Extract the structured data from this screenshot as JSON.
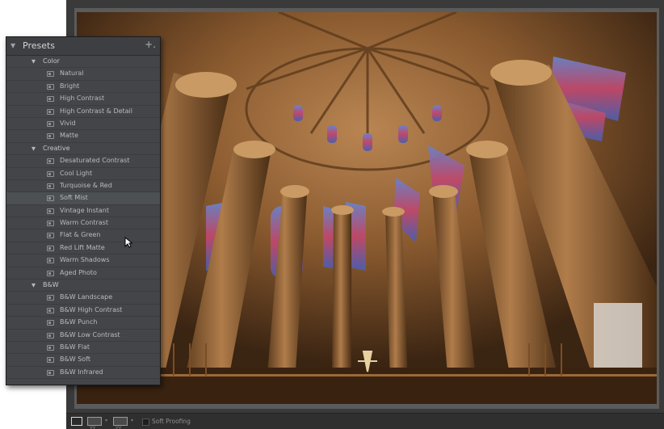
{
  "presets_panel": {
    "title": "Presets",
    "add_label": "+.",
    "folders": [
      {
        "name": "Color",
        "items": [
          "Natural",
          "Bright",
          "High Contrast",
          "High Contrast & Detail",
          "Vivid",
          "Matte"
        ]
      },
      {
        "name": "Creative",
        "items": [
          "Desaturated Contrast",
          "Cool Light",
          "Turquoise & Red",
          "Soft Mist",
          "Vintage Instant",
          "Warm Contrast",
          "Flat & Green",
          "Red Lift Matte",
          "Warm Shadows",
          "Aged Photo"
        ]
      },
      {
        "name": "B&W",
        "items": [
          "B&W Landscape",
          "B&W High Contrast",
          "B&W Punch",
          "B&W Low Contrast",
          "B&W Flat",
          "B&W Soft",
          "B&W Infrared"
        ]
      }
    ],
    "hovered_item": "Soft Mist"
  },
  "toolbar": {
    "view_buttons": [
      "loupe-view",
      "before-after-view",
      "survey-view"
    ],
    "before_after_label": "YY",
    "survey_label": "YY",
    "soft_proofing_label": "Soft Proofing",
    "soft_proofing_checked": false
  },
  "icons": {
    "panel_toggle": "triangle-down-icon",
    "folder_expanded": "triangle-down-icon",
    "preset": "preset-icon",
    "cursor": "mouse-pointer-icon"
  },
  "colors": {
    "panel_bg": "#434548",
    "window_bg": "#3a3a3a",
    "photo_tone": "#8a5a2c"
  }
}
